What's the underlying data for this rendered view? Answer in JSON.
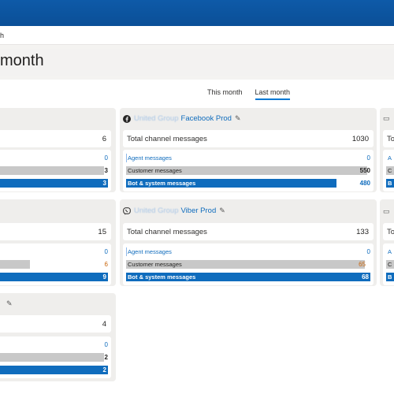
{
  "breadcrumb": "h",
  "page_title": "month",
  "tabs": [
    {
      "label": "This month",
      "active": false
    },
    {
      "label": "Last month",
      "active": true
    }
  ],
  "labels": {
    "total": "Total channel messages",
    "agent": "Agent messages",
    "customer": "Customer messages",
    "bot": "Bot & system messages",
    "total_short": "To",
    "a_short": "A",
    "c_short": "C",
    "b_short": "B"
  },
  "cards": {
    "left_top": {
      "total": "6",
      "agent": "0",
      "customer": "3",
      "bot": "3"
    },
    "left_mid": {
      "total": "15",
      "agent": "0",
      "customer": "6",
      "bot": "9"
    },
    "left_bottom": {
      "total": "4",
      "agent": "0",
      "customer": "2",
      "bot": "2"
    },
    "facebook": {
      "title_blur": "United Group",
      "title": "Facebook Prod",
      "icon": "facebook-icon",
      "total": "1030",
      "agent": "0",
      "customer": "550",
      "bot": "480"
    },
    "viber": {
      "title_blur": "United Group",
      "title": "Viber Prod",
      "icon": "viber-icon",
      "total": "133",
      "agent": "0",
      "customer": "65",
      "bot": "68"
    }
  },
  "colors": {
    "topbar": "#0b4f97",
    "accent": "#0f6cbd",
    "customer_bar": "#c8c8c8"
  }
}
